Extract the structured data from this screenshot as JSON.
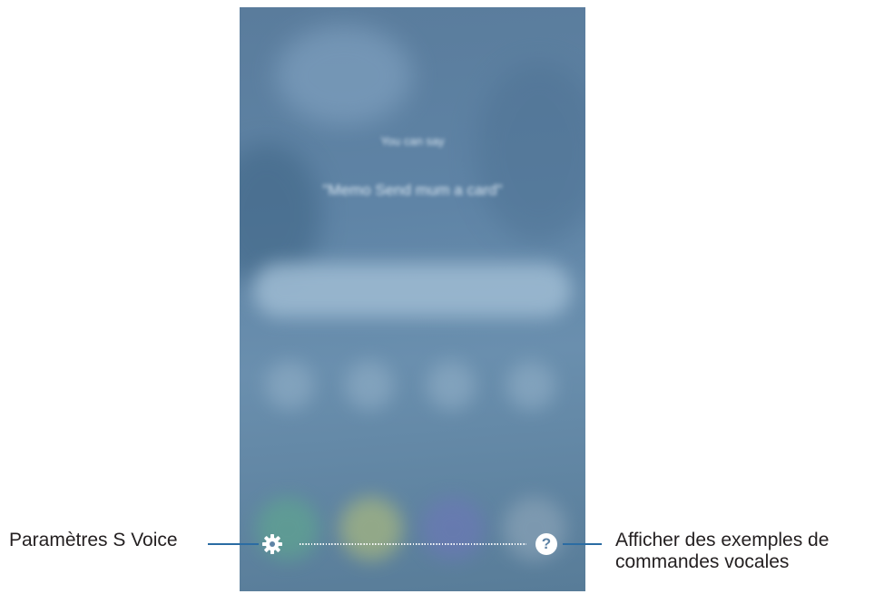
{
  "screen": {
    "blurred_prompt_line1": "You can say",
    "blurred_prompt_line2": "\"Memo Send mum a card\""
  },
  "controls": {
    "settings_icon": "gear-icon",
    "help_icon": "question-icon",
    "help_glyph": "?"
  },
  "callouts": {
    "settings": "Paramètres S Voice",
    "help_line1": "Afficher des exemples de",
    "help_line2": "commandes vocales"
  },
  "colors": {
    "leader_line": "#2b6ca3",
    "screen_background": "#5f84a6"
  }
}
